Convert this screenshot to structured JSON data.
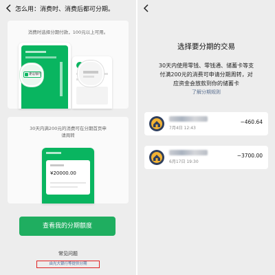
{
  "left": {
    "header": {
      "title": "怎么用：消费时、消费后都可分期。"
    },
    "card1": {
      "caption": "消费时选择分期付款，100元以上可用。",
      "chip_label": "建设银行",
      "phone_label": "分期"
    },
    "card2": {
      "caption_line1": "30天内满200元的消费可在分期首页申",
      "caption_line2": "请周转",
      "amount": "¥20000.00"
    },
    "cta_label": "查看我的分期额度",
    "faq_label": "常见问题",
    "footer_note": "由光大银行等提供分期"
  },
  "right": {
    "title": "选择要分期的交易",
    "description_line1": "30天内使用零钱、零钱通、储蓄卡等支",
    "description_line2": "付满200元的消费可申请分期周转，对",
    "description_line3": "应资金会放款到你的储蓄卡",
    "rules_link": "了解分期规则",
    "transactions": [
      {
        "time": "7月4日 12:43",
        "amount": "−460.64"
      },
      {
        "time": "6月17日 19:30",
        "amount": "−3700.00"
      }
    ]
  },
  "colors": {
    "brand_green": "#09b560",
    "background": "#ededed",
    "highlight_red": "#e02020"
  }
}
